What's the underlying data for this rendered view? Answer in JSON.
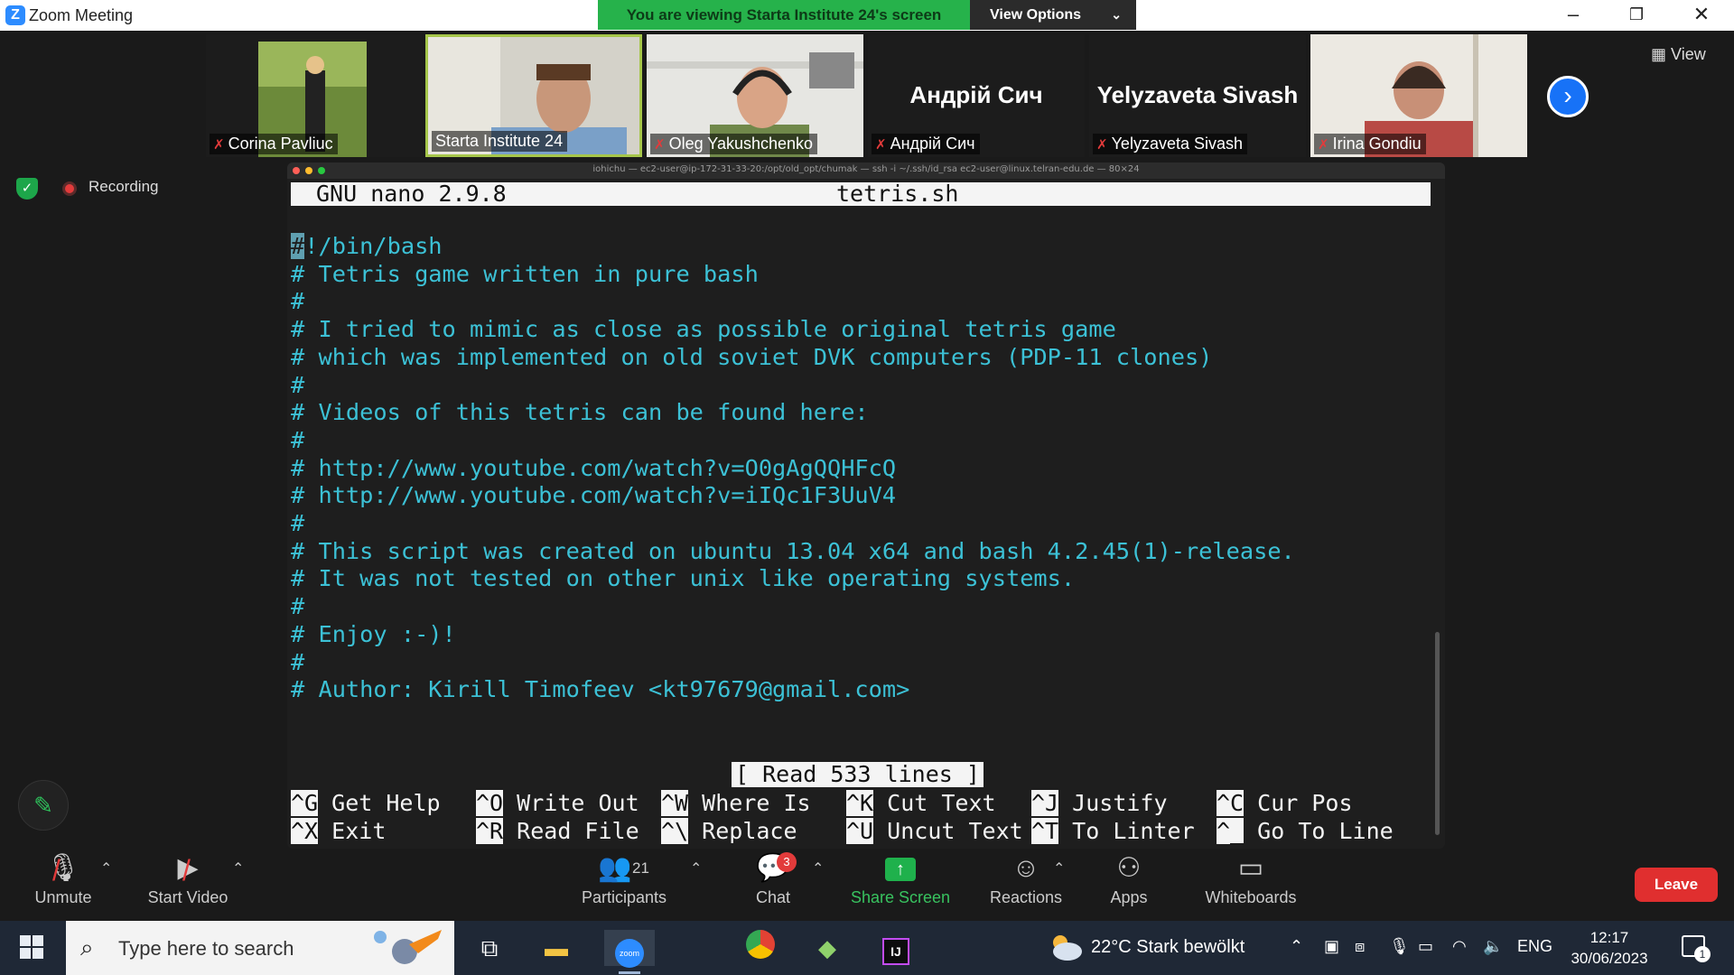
{
  "window": {
    "app_title": "Zoom Meeting",
    "banner": "You are viewing Starta Institute 24's screen",
    "view_options": "View Options",
    "view_label": "View"
  },
  "participants": [
    {
      "name": "Corina Pavliuc",
      "muted": true,
      "has_video": true
    },
    {
      "name": "Starta Institute 24",
      "muted": false,
      "has_video": true,
      "active": true
    },
    {
      "name": "Oleg Yakushchenko",
      "muted": true,
      "has_video": true
    },
    {
      "name": "Андрій Сич",
      "muted": true,
      "has_video": false
    },
    {
      "name": "Yelyzaveta Sivash",
      "muted": true,
      "has_video": false
    },
    {
      "name": "Irina Gondiu",
      "muted": true,
      "has_video": true
    }
  ],
  "recording": {
    "label": "Recording"
  },
  "terminal": {
    "window_title": "iohichu — ec2-user@ip-172-31-33-20:/opt/old_opt/chumak — ssh -i ~/.ssh/id_rsa ec2-user@linux.telran-edu.de — 80×24",
    "nano_version": "GNU nano 2.9.8",
    "file_name": "tetris.sh",
    "cursor_char": "#",
    "first_line_rest": "!/bin/bash",
    "lines": [
      "",
      "# Tetris game written in pure bash",
      "#",
      "# I tried to mimic as close as possible original tetris game",
      "# which was implemented on old soviet DVK computers (PDP-11 clones)",
      "#",
      "# Videos of this tetris can be found here:",
      "#",
      "# http://www.youtube.com/watch?v=O0gAgQQHFcQ",
      "# http://www.youtube.com/watch?v=iIQc1F3UuV4",
      "#",
      "# This script was created on ubuntu 13.04 x64 and bash 4.2.45(1)-release.",
      "# It was not tested on other unix like operating systems.",
      "#",
      "# Enjoy :-)!",
      "#",
      "# Author: Kirill Timofeev <kt97679@gmail.com>"
    ],
    "status_message": "[ Read 533 lines ]",
    "shortcuts": [
      {
        "key": "^G",
        "label": "Get Help"
      },
      {
        "key": "^O",
        "label": "Write Out"
      },
      {
        "key": "^W",
        "label": "Where Is"
      },
      {
        "key": "^K",
        "label": "Cut Text"
      },
      {
        "key": "^J",
        "label": "Justify"
      },
      {
        "key": "^C",
        "label": "Cur Pos"
      },
      {
        "key": "^X",
        "label": "Exit"
      },
      {
        "key": "^R",
        "label": "Read File"
      },
      {
        "key": "^\\",
        "label": "Replace"
      },
      {
        "key": "^U",
        "label": "Uncut Text"
      },
      {
        "key": "^T",
        "label": "To Linter"
      },
      {
        "key": "^_",
        "label": "Go To Line"
      }
    ]
  },
  "toolbar": {
    "unmute": "Unmute",
    "start_video": "Start Video",
    "participants": "Participants",
    "participants_count": "21",
    "chat": "Chat",
    "chat_badge": "3",
    "share_screen": "Share Screen",
    "reactions": "Reactions",
    "apps": "Apps",
    "whiteboards": "Whiteboards",
    "leave": "Leave"
  },
  "taskbar": {
    "search_placeholder": "Type here to search",
    "weather": "22°C  Stark bewölkt",
    "language": "ENG",
    "time": "12:17",
    "date": "30/06/2023",
    "notifications": "1"
  },
  "colors": {
    "banner_green": "#26b24b",
    "terminal_text": "#3cc1d6",
    "leave_red": "#e02f2f",
    "accent_blue": "#1772f7"
  }
}
